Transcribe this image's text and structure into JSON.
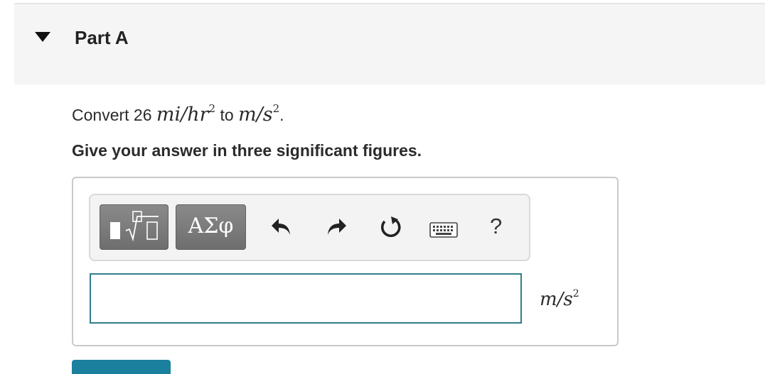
{
  "part": {
    "title": "Part A",
    "expanded": true
  },
  "question": {
    "prefix": "Convert 26",
    "from_unit": "mi/hr",
    "from_exponent": "2",
    "middle": "to",
    "to_unit": "m/s",
    "to_exponent": "2",
    "suffix": "."
  },
  "instruction": "Give your answer in three significant figures.",
  "toolbar": {
    "templates_icon": "templates-icon",
    "symbols_label": "ΑΣφ",
    "undo_icon": "undo-icon",
    "redo_icon": "redo-icon",
    "reset_icon": "reset-icon",
    "keyboard_icon": "keyboard-icon",
    "help_label": "?"
  },
  "answer": {
    "value": "",
    "unit": "m/s",
    "unit_exponent": "2"
  },
  "colors": {
    "header_bg": "#f5f5f5",
    "input_border": "#317d8c",
    "toolbar_button": "#7a7a7a",
    "submit_button": "#1b7f9e"
  }
}
